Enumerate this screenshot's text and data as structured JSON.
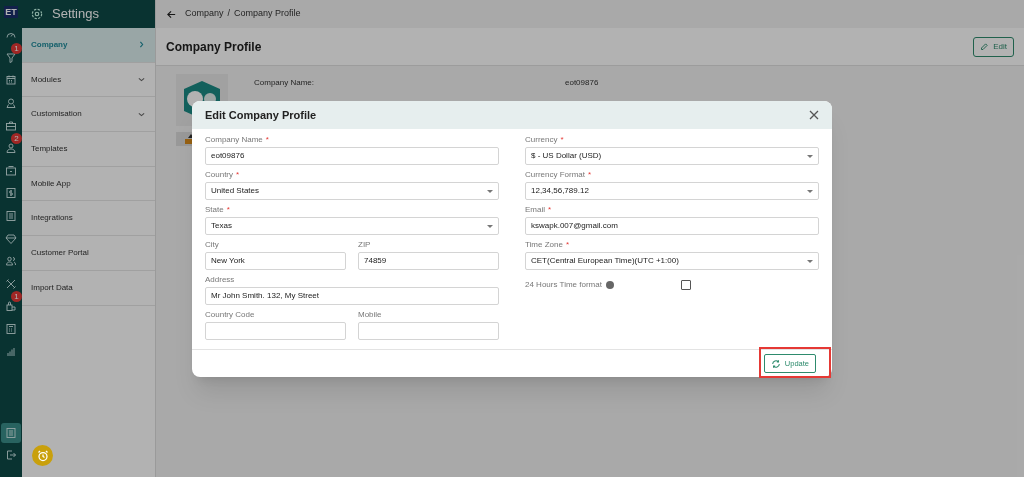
{
  "rail": {
    "logo": "ET",
    "items": [
      {
        "kind": "gauge"
      },
      {
        "kind": "funnel",
        "badge": "1"
      },
      {
        "kind": "calendar"
      },
      {
        "kind": "pin"
      },
      {
        "kind": "briefcase"
      },
      {
        "kind": "person",
        "badge": "2"
      },
      {
        "kind": "folder"
      },
      {
        "kind": "dollar"
      },
      {
        "kind": "list"
      },
      {
        "kind": "gem"
      },
      {
        "kind": "people"
      },
      {
        "kind": "tools"
      },
      {
        "kind": "bag",
        "badge": "1"
      },
      {
        "kind": "calculator"
      },
      {
        "kind": "chart"
      }
    ],
    "bottom": [
      {
        "kind": "settings",
        "selected": true
      },
      {
        "kind": "logout",
        "selected": false
      }
    ]
  },
  "sidebar": {
    "title": "Settings",
    "items": [
      {
        "label": "Company",
        "selected": true,
        "submenu": true
      },
      {
        "label": "Modules",
        "selected": false,
        "submenu": true
      },
      {
        "label": "Customisation",
        "selected": false,
        "submenu": true
      },
      {
        "label": "Templates",
        "selected": false
      },
      {
        "label": "Mobile App",
        "selected": false
      },
      {
        "label": "Integrations",
        "selected": false
      },
      {
        "label": "Customer Portal",
        "selected": false
      },
      {
        "label": "Import Data",
        "selected": false
      }
    ]
  },
  "breadcrumb": {
    "items": [
      "Company",
      "Company Profile"
    ],
    "separator": "/"
  },
  "page": {
    "title": "Company Profile",
    "edit_button": "Edit",
    "fields": [
      {
        "label": "Company Name:",
        "value": "eot09876"
      }
    ]
  },
  "modal": {
    "title": "Edit Company Profile",
    "left": [
      {
        "kind": "input",
        "label": "Company Name",
        "required_mark": "*",
        "value": "eot09876"
      },
      {
        "kind": "select",
        "label": "Country",
        "required_mark": "*",
        "value": "United States"
      },
      {
        "kind": "select",
        "label": "State",
        "required_mark": "*",
        "value": "Texas"
      },
      {
        "kind": "pair",
        "items": [
          {
            "label": "City",
            "value": "New York"
          },
          {
            "label": "ZIP",
            "value": "74859"
          }
        ]
      },
      {
        "kind": "input",
        "label": "Address",
        "value": "Mr John Smith. 132, My Street"
      },
      {
        "kind": "pair",
        "items": [
          {
            "label": "Country Code"
          },
          {
            "label": "Mobile"
          }
        ]
      }
    ],
    "right": [
      {
        "kind": "select",
        "label": "Currency",
        "required_mark": "*",
        "value": "$ - US Dollar (USD)"
      },
      {
        "kind": "select",
        "label": "Currency Format",
        "required_mark": "*",
        "value": "12,34,56,789.12"
      },
      {
        "kind": "input",
        "label": "Email",
        "required_mark": "*",
        "value": "kswapk.007@gmail.com"
      },
      {
        "kind": "select",
        "label": "Time Zone",
        "required_mark": "*",
        "value": "CET(Central European Time)(UTC +1:00)"
      },
      {
        "kind": "checkbox",
        "label": "24 Hours Time format",
        "checked": false
      }
    ],
    "update_button": {
      "label": "Update",
      "highlighted": true
    }
  }
}
